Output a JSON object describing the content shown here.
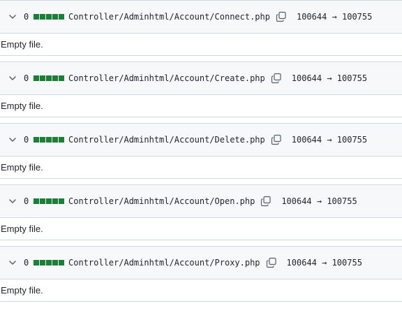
{
  "files": [
    {
      "changes": "0",
      "path": "Controller/Adminhtml/Account/Connect.php",
      "mode_change": "100644 → 100755",
      "body_text": "Empty file."
    },
    {
      "changes": "0",
      "path": "Controller/Adminhtml/Account/Create.php",
      "mode_change": "100644 → 100755",
      "body_text": "Empty file."
    },
    {
      "changes": "0",
      "path": "Controller/Adminhtml/Account/Delete.php",
      "mode_change": "100644 → 100755",
      "body_text": "Empty file."
    },
    {
      "changes": "0",
      "path": "Controller/Adminhtml/Account/Open.php",
      "mode_change": "100644 → 100755",
      "body_text": "Empty file."
    },
    {
      "changes": "0",
      "path": "Controller/Adminhtml/Account/Proxy.php",
      "mode_change": "100644 → 100755",
      "body_text": "Empty file."
    }
  ],
  "icons": {
    "collapse": "chevron-down-icon",
    "copy": "copy-icon"
  },
  "colors": {
    "diffstat_neutral": "#1a7f37",
    "header_bg": "#f6f8fa",
    "border": "#d0d7de"
  }
}
